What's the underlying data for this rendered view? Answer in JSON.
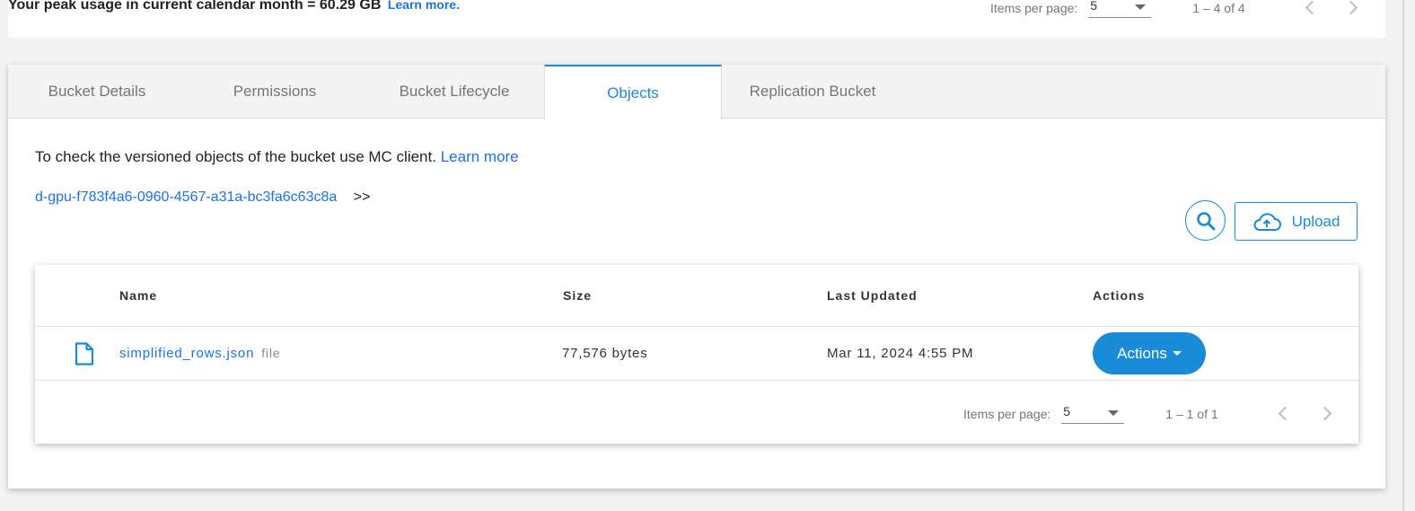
{
  "usage": {
    "text": "Your peak usage in current calendar month = 60.29 GB",
    "learn_more": "Learn more."
  },
  "top_pager": {
    "items_per_page_label": "Items per page:",
    "items_per_page_value": "5",
    "range": "1 – 4 of 4"
  },
  "tabs": [
    {
      "label": "Bucket Details",
      "active": false
    },
    {
      "label": "Permissions",
      "active": false
    },
    {
      "label": "Bucket Lifecycle",
      "active": false
    },
    {
      "label": "Objects",
      "active": true
    },
    {
      "label": "Replication Bucket",
      "active": false
    }
  ],
  "objects": {
    "info_text": "To check the versioned objects of the bucket use MC client.",
    "info_link": "Learn more",
    "breadcrumb_bucket": "d-gpu-f783f4a6-0960-4567-a31a-bc3fa6c63c8a",
    "breadcrumb_sep": ">>",
    "upload_label": "Upload",
    "table": {
      "headers": {
        "name": "Name",
        "size": "Size",
        "last_updated": "Last Updated",
        "actions": "Actions"
      },
      "rows": [
        {
          "name": "simplified_rows.json",
          "type": "file",
          "size": "77,576 bytes",
          "last_updated": "Mar 11, 2024 4:55 PM",
          "action_label": "Actions"
        }
      ]
    },
    "pager": {
      "items_per_page_label": "Items per page:",
      "items_per_page_value": "5",
      "range": "1 – 1 of 1"
    }
  },
  "colors": {
    "accent": "#1a8bd6",
    "link": "#1a73e8",
    "tab_bg": "#f4f4f4",
    "page_bg": "#f3f3f3"
  }
}
